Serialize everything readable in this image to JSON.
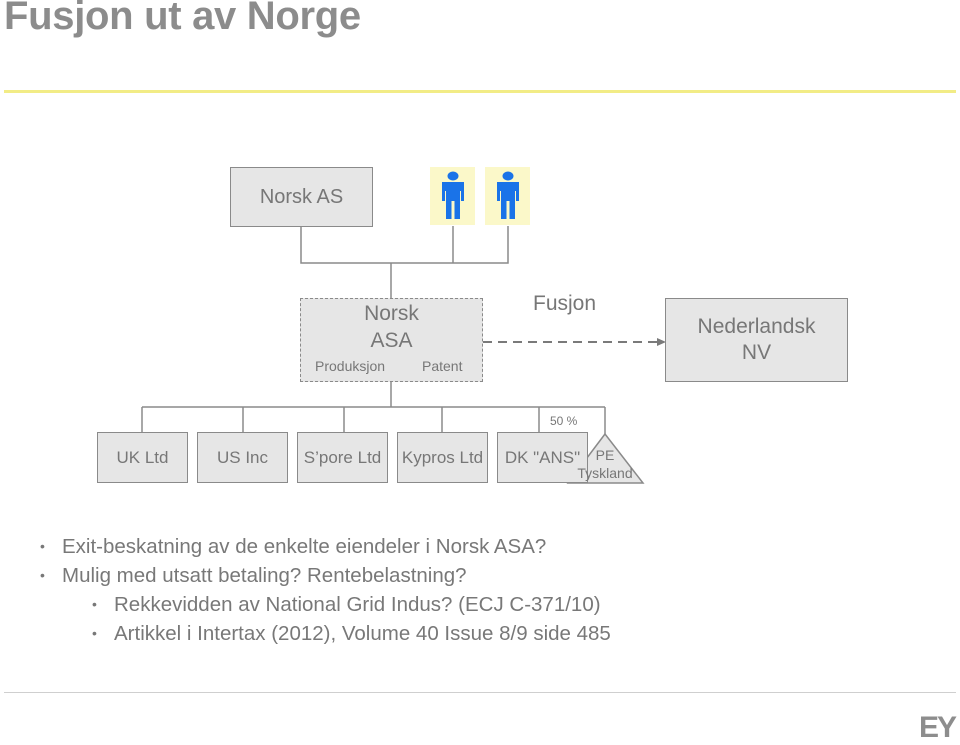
{
  "slide": {
    "title": "Fusjon ut av Norge",
    "logo": "EY"
  },
  "diagram": {
    "top_entity": "Norsk AS",
    "owners": [
      {
        "icon": "person-icon"
      },
      {
        "icon": "person-icon"
      }
    ],
    "merging_entity": {
      "name_line1": "Norsk",
      "name_line2": "ASA",
      "assets": [
        "Produksjon",
        "Patent"
      ]
    },
    "merger_label": "Fusjon",
    "target_entity": {
      "name_line1": "Nederlandsk",
      "name_line2": "NV"
    },
    "subsidiaries": [
      {
        "name": "UK Ltd"
      },
      {
        "name": "US Inc"
      },
      {
        "name": "S’pore Ltd"
      },
      {
        "name": "Kypros Ltd"
      },
      {
        "name": "DK \"ANS\"",
        "ownership": "50 %"
      }
    ],
    "pe": {
      "line1": "PE",
      "line2": "Tyskland"
    }
  },
  "bullets": [
    {
      "level": 1,
      "text": "Exit-beskatning av de enkelte eiendeler i Norsk ASA?"
    },
    {
      "level": 1,
      "text": "Mulig med utsatt betaling? Rentebelastning?"
    },
    {
      "level": 2,
      "text": "Rekkevidden av National Grid Indus? (ECJ C-371/10)"
    },
    {
      "level": 2,
      "text": "Artikkel i Intertax (2012), Volume 40 Issue 8/9 side 485"
    }
  ],
  "colors": {
    "title": "#8c8c8c",
    "accent_rule": "#f2ec86",
    "box_fill": "#e6e6e6",
    "box_border": "#8a8a8a",
    "person_fill": "#1a73e8",
    "person_bg": "#fbf8c9"
  }
}
